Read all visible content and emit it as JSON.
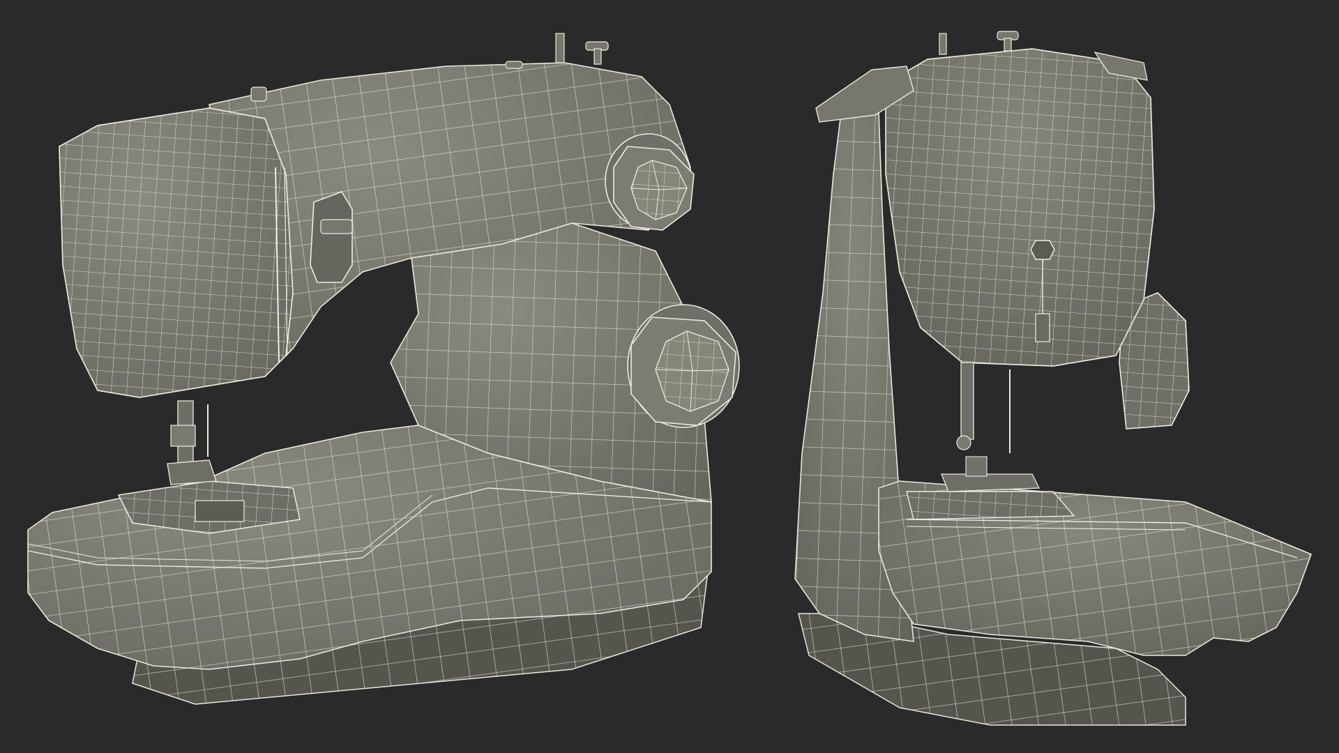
{
  "scene": {
    "background_color": "#2a2a2a",
    "surface_color": "#7a7a70",
    "surface_dark_color": "#5a5a52",
    "surface_light_color": "#8c8c82",
    "wire_color": "#e8e8dc"
  },
  "models": [
    {
      "view": "three-quarter"
    },
    {
      "view": "front"
    }
  ]
}
